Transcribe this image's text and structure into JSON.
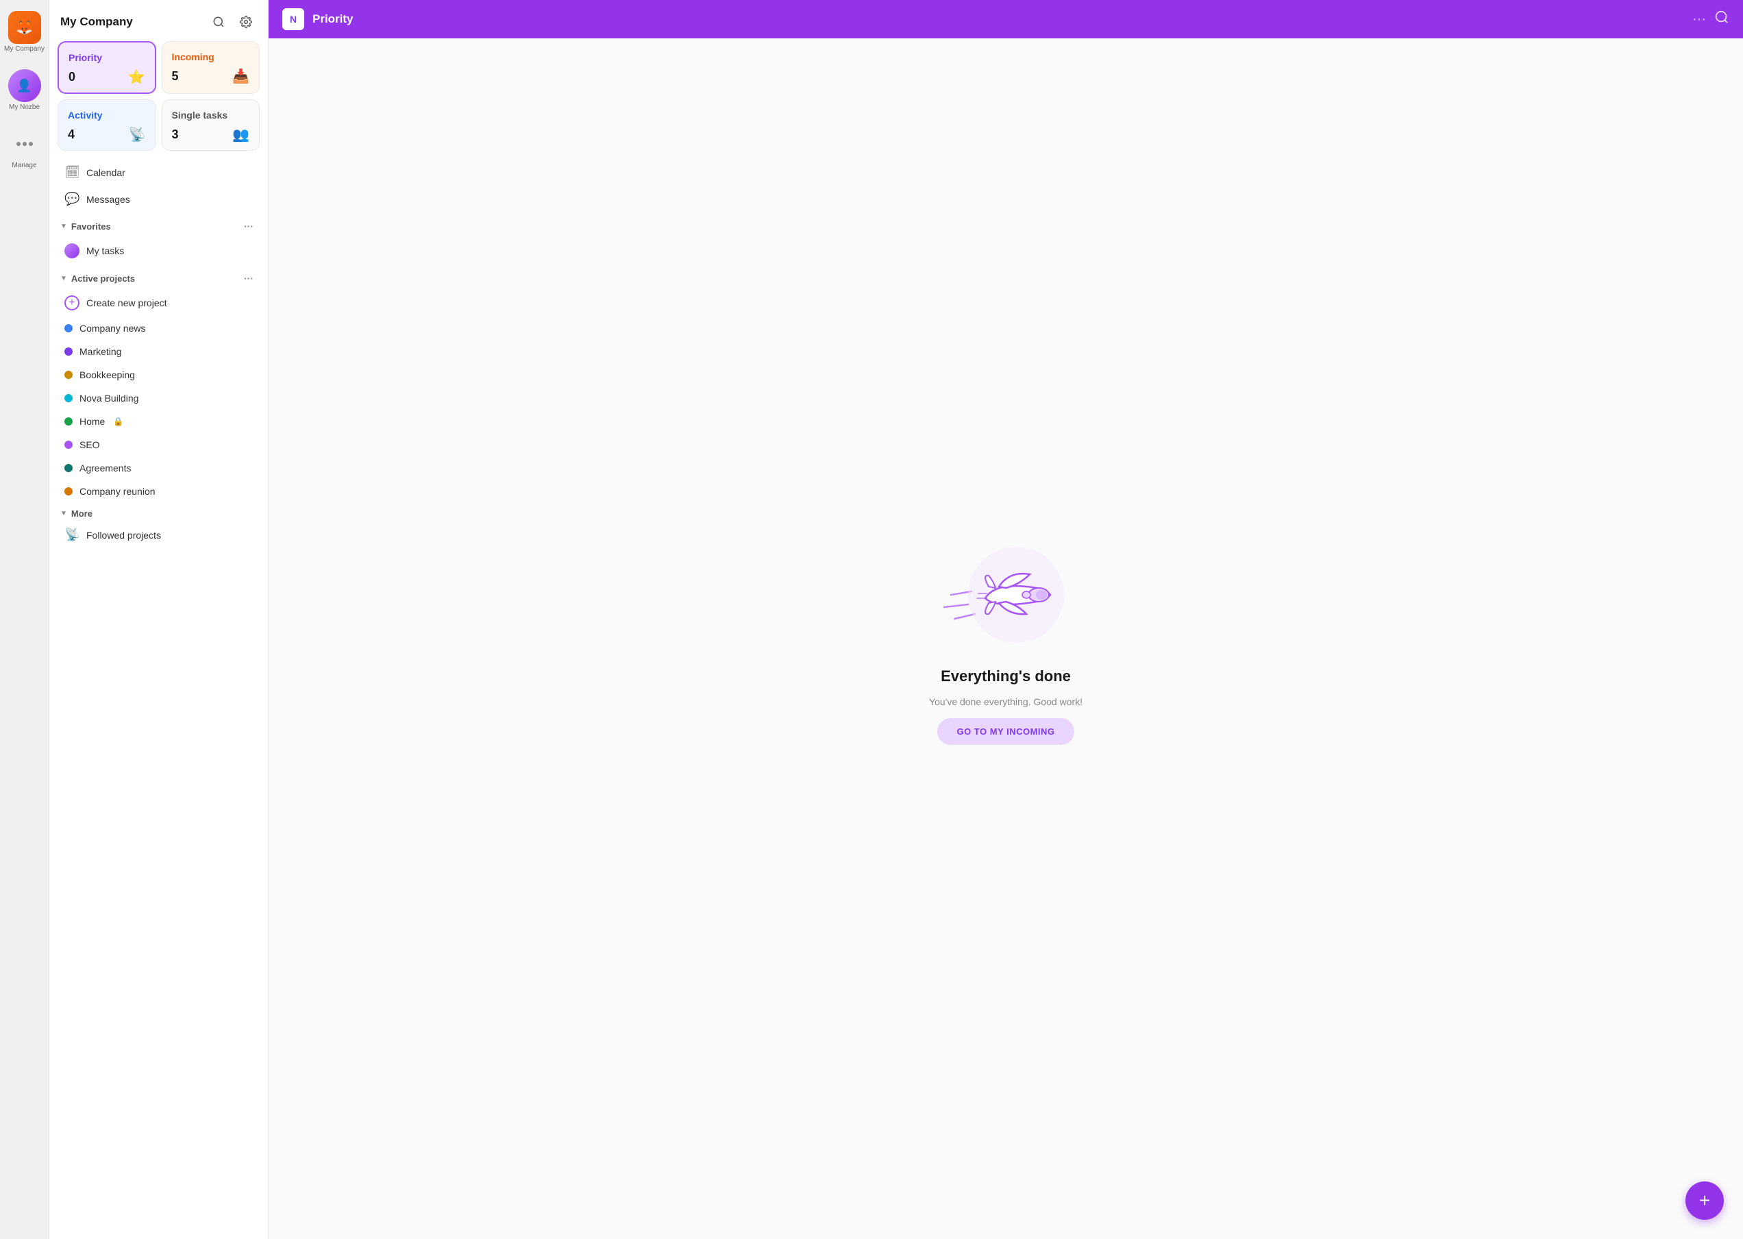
{
  "iconBar": {
    "appName": "My Company",
    "myNozbeLabel": "My Nozbe",
    "manageLabel": "Manage"
  },
  "sidebar": {
    "title": "My Company",
    "cards": [
      {
        "id": "priority",
        "label": "Priority",
        "count": "0",
        "icon": "⭐",
        "type": "priority"
      },
      {
        "id": "incoming",
        "label": "Incoming",
        "count": "5",
        "icon": "📥",
        "type": "incoming"
      },
      {
        "id": "activity",
        "label": "Activity",
        "count": "4",
        "icon": "📡",
        "type": "activity"
      },
      {
        "id": "single-tasks",
        "label": "Single tasks",
        "count": "3",
        "icon": "👥",
        "type": "single"
      }
    ],
    "navItems": [
      {
        "id": "calendar",
        "label": "Calendar",
        "icon": "🗓"
      },
      {
        "id": "messages",
        "label": "Messages",
        "icon": "💬"
      }
    ],
    "favoritesSection": {
      "label": "Favorites",
      "items": [
        {
          "id": "my-tasks",
          "label": "My tasks"
        }
      ]
    },
    "activeProjectsSection": {
      "label": "Active projects",
      "items": [
        {
          "id": "create-new-project",
          "label": "Create new project",
          "color": null,
          "isCreate": true
        },
        {
          "id": "company-news",
          "label": "Company news",
          "color": "#3b82f6"
        },
        {
          "id": "marketing",
          "label": "Marketing",
          "color": "#7c3aed"
        },
        {
          "id": "bookkeeping",
          "label": "Bookkeeping",
          "color": "#ca8a04"
        },
        {
          "id": "nova-building",
          "label": "Nova Building",
          "color": "#06b6d4"
        },
        {
          "id": "home",
          "label": "Home",
          "color": "#16a34a",
          "lock": true
        },
        {
          "id": "seo",
          "label": "SEO",
          "color": "#a855f7"
        },
        {
          "id": "agreements",
          "label": "Agreements",
          "color": "#0f766e"
        },
        {
          "id": "company-reunion",
          "label": "Company reunion",
          "color": "#d97706"
        }
      ]
    },
    "moreSection": {
      "label": "More",
      "items": [
        {
          "id": "followed-projects",
          "label": "Followed projects",
          "icon": "📡"
        }
      ]
    }
  },
  "topbar": {
    "logoText": "N",
    "title": "Priority",
    "dotsLabel": "···"
  },
  "emptyState": {
    "title": "Everything's done",
    "subtitle": "You've done everything. Good work!",
    "buttonLabel": "GO TO MY INCOMING"
  },
  "fab": {
    "label": "+"
  },
  "colors": {
    "priority": "#9333ea",
    "incoming": "#ea580c",
    "activity": "#2563eb"
  }
}
